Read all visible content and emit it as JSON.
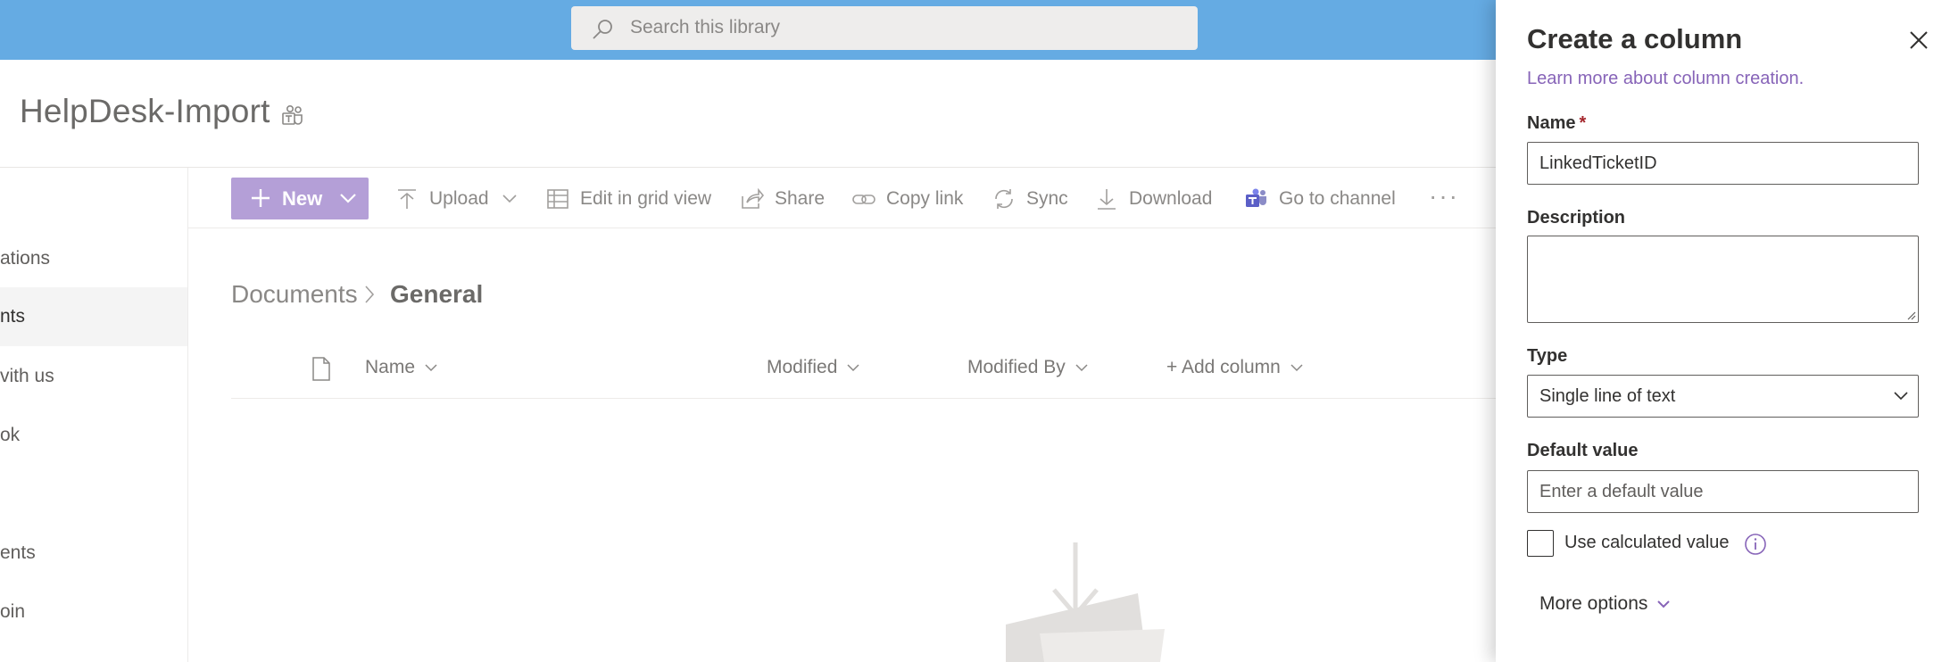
{
  "search": {
    "placeholder": "Search this library",
    "icon": "search-icon"
  },
  "site": {
    "title": "HelpDesk-Import",
    "badge_icon": "teams-icon"
  },
  "left_nav": {
    "items": [
      {
        "label": "ations",
        "active": false
      },
      {
        "label": "nts",
        "active": true
      },
      {
        "label": "vith us",
        "active": false
      },
      {
        "label": "ok",
        "active": false
      },
      {
        "label": "ents",
        "active": false
      },
      {
        "label": "oin",
        "active": false
      }
    ]
  },
  "command_bar": {
    "new_label": "New",
    "upload_label": "Upload",
    "edit_grid_label": "Edit in grid view",
    "share_label": "Share",
    "copy_link_label": "Copy link",
    "sync_label": "Sync",
    "download_label": "Download",
    "go_to_channel_label": "Go to channel",
    "more_label": "···"
  },
  "breadcrumb": {
    "parent": "Documents",
    "current": "General"
  },
  "columns": {
    "name": "Name",
    "modified": "Modified",
    "modified_by": "Modified By",
    "add_column": "+ Add column"
  },
  "panel": {
    "title": "Create a column",
    "learn_more": "Learn more about column creation.",
    "name_label": "Name",
    "required_marker": "*",
    "name_value": "LinkedTicketID",
    "description_label": "Description",
    "description_value": "",
    "type_label": "Type",
    "type_value": "Single line of text",
    "default_label": "Default value",
    "default_placeholder": "Enter a default value",
    "calculated_label": "Use calculated value",
    "calculated_checked": false,
    "more_options": "More options"
  },
  "colors": {
    "topbar": "#65abe3",
    "accent": "#b49fd7",
    "link": "#8764b8",
    "panel_bg": "#ffffff"
  }
}
